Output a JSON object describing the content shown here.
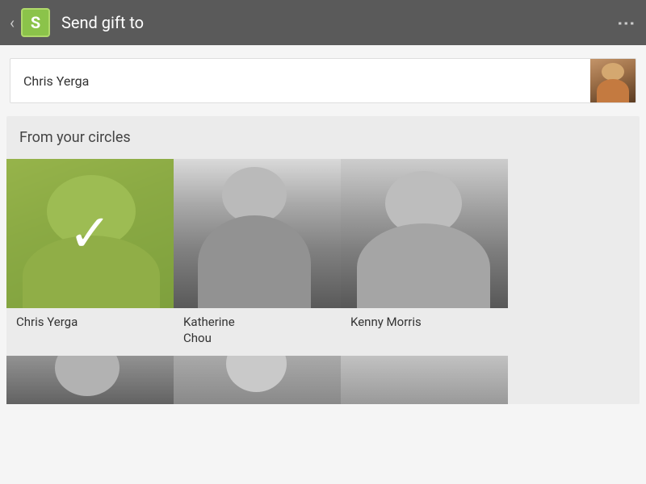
{
  "header": {
    "back_icon": "‹",
    "logo_letter": "S",
    "title": "Send gift to",
    "menu_icon": "⋮"
  },
  "selected_contact": {
    "name": "Chris Yerga"
  },
  "circles": {
    "section_title": "From your circles",
    "contacts": [
      {
        "id": "chris-yerga",
        "name": "Chris Yerga",
        "selected": true
      },
      {
        "id": "katherine-chou",
        "name": "Katherine\nChou",
        "selected": false
      },
      {
        "id": "kenny-morris",
        "name": "Kenny Morris",
        "selected": false
      }
    ]
  },
  "colors": {
    "header_bg": "#5a5a5a",
    "logo_bg": "#8bc34a",
    "selected_overlay": "#8bc34a",
    "accent": "#8bc34a"
  }
}
